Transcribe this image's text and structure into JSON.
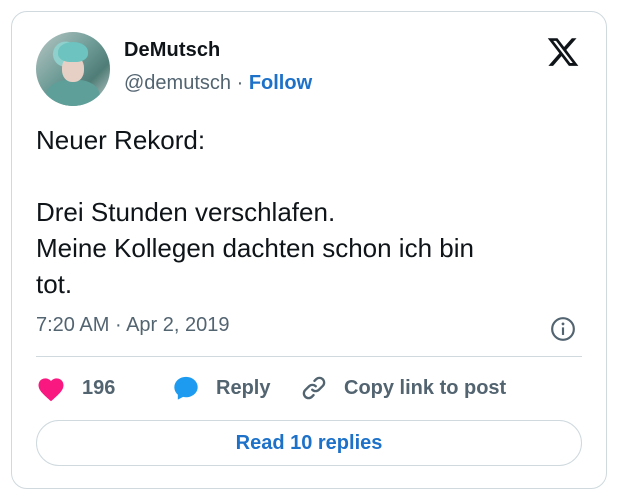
{
  "author": {
    "name": "DeMutsch",
    "handle": "@demutsch",
    "separator": "·",
    "follow_label": "Follow"
  },
  "tweet": {
    "lines": [
      "Neuer Rekord:",
      "",
      "Drei Stunden verschlafen.",
      "Meine Kollegen dachten schon ich bin",
      "tot."
    ],
    "time": "7:20 AM",
    "separator": "·",
    "date": "Apr 2, 2019"
  },
  "actions": {
    "like_count": "196",
    "reply_label": "Reply",
    "copy_link_label": "Copy link to post"
  },
  "read_replies_label": "Read 10 replies",
  "icons": {
    "brand": "x-logo-icon",
    "info": "info-icon",
    "like": "heart-icon",
    "reply": "speech-bubble-icon",
    "copy_link": "link-icon"
  },
  "colors": {
    "accent": "#1d71c9",
    "like": "#f91880",
    "reply_icon": "#1d9bf0",
    "secondary_text": "#536471",
    "border": "#cfd9de"
  }
}
